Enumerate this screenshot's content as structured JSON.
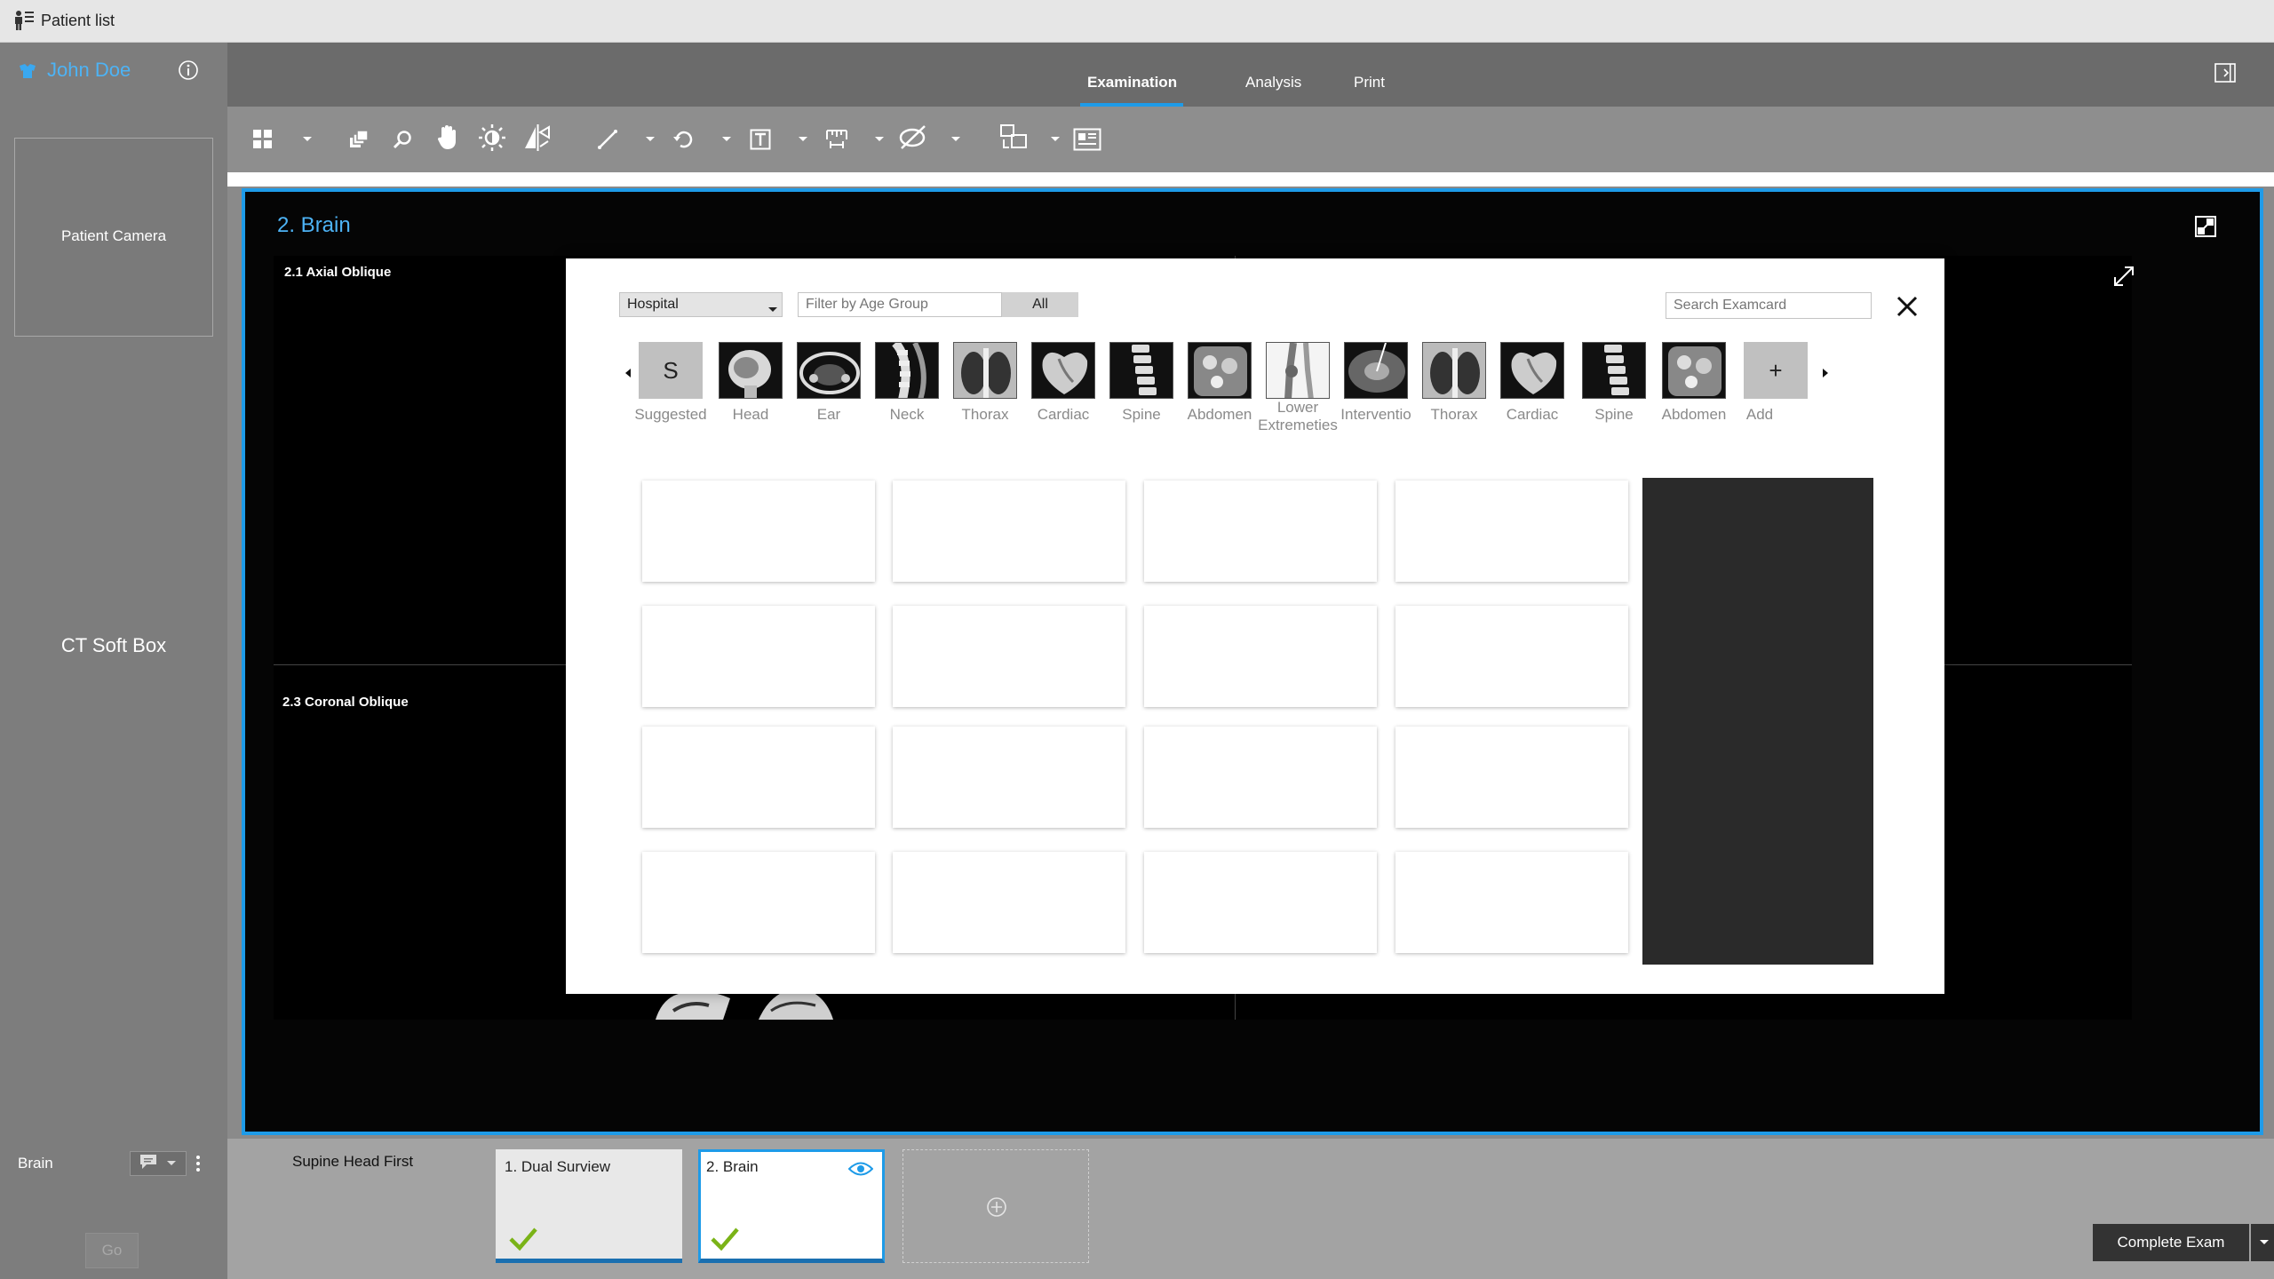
{
  "app": {
    "title": "Patient list"
  },
  "patient": {
    "name": "John Doe",
    "camera_label": "Patient Camera",
    "protocol_label": "CT Soft Box"
  },
  "header": {
    "tabs": [
      {
        "label": "Examination"
      },
      {
        "label": "Analysis"
      },
      {
        "label": "Print"
      }
    ]
  },
  "viewer": {
    "title": "2. Brain",
    "viewport_top": "2.1 Axial Oblique",
    "viewport_bottom": "2.3 Coronal Oblique"
  },
  "sidebar": {
    "scan_name": "Brain",
    "go_label": "Go"
  },
  "bottom": {
    "position": "Supine Head First",
    "series": [
      {
        "label": "1. Dual Surview"
      },
      {
        "label": "2. Brain"
      }
    ],
    "complete_label": "Complete Exam"
  },
  "dialog": {
    "source_select": "Hospital",
    "age_placeholder": "Filter by Age Group",
    "all_label": "All",
    "search_placeholder": "Search Examcard",
    "anatomy": [
      {
        "label": "Suggested",
        "glyph": "S"
      },
      {
        "label": "Head"
      },
      {
        "label": "Ear"
      },
      {
        "label": "Neck"
      },
      {
        "label": "Thorax"
      },
      {
        "label": "Cardiac"
      },
      {
        "label": "Spine"
      },
      {
        "label": "Abdomen"
      },
      {
        "label": "Lower Extremeties"
      },
      {
        "label": "Interventio"
      },
      {
        "label": "Thorax"
      },
      {
        "label": "Cardiac"
      },
      {
        "label": "Spine"
      },
      {
        "label": "Abdomen"
      },
      {
        "label": "Add",
        "glyph": "+"
      }
    ]
  },
  "colors": {
    "accent": "#1e9be8",
    "check": "#7ab317",
    "panel_dark": "#2a2a2a"
  }
}
